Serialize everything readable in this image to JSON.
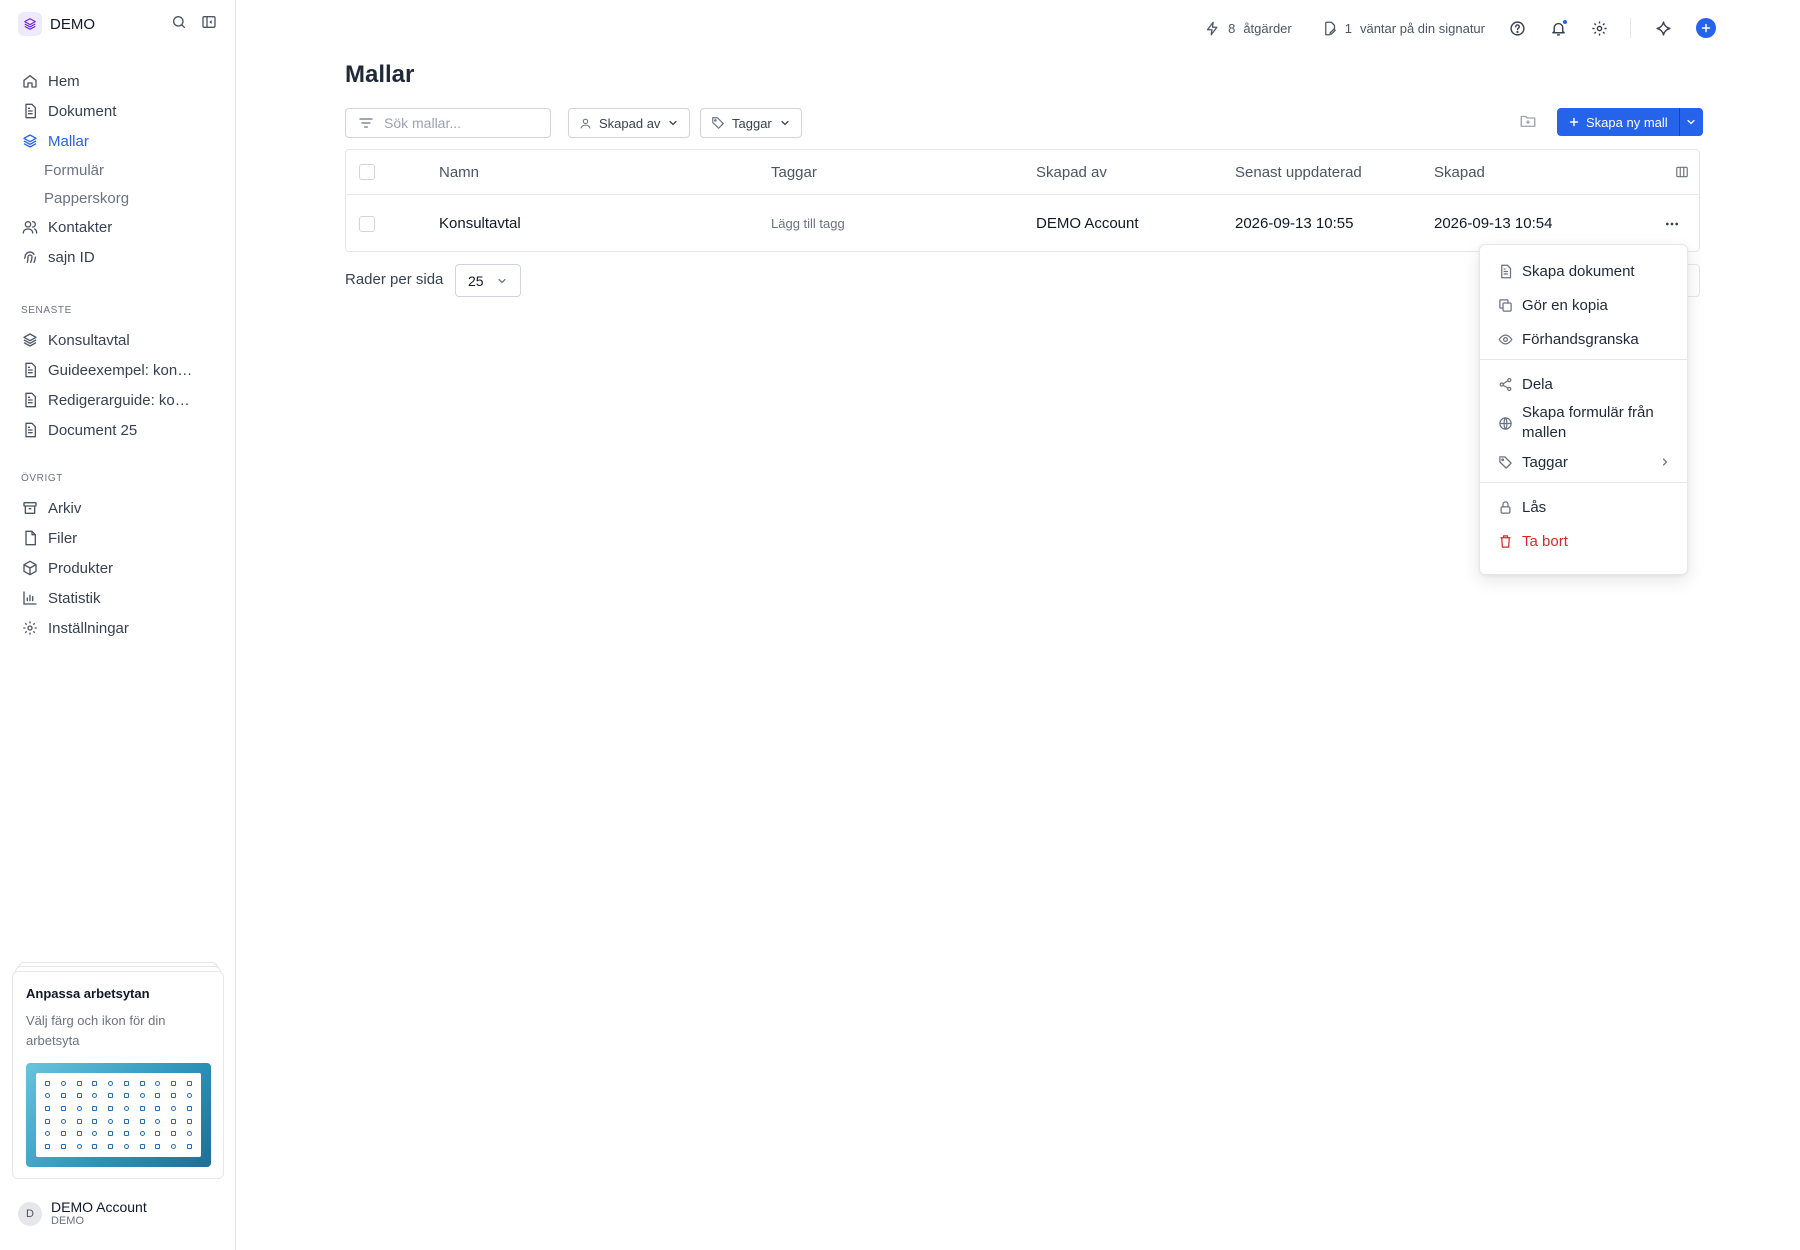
{
  "workspace": {
    "name": "DEMO"
  },
  "sidebar": {
    "nav": [
      {
        "label": "Hem",
        "icon": "home-icon"
      },
      {
        "label": "Dokument",
        "icon": "document-icon"
      },
      {
        "label": "Mallar",
        "icon": "layers-icon",
        "active": true
      },
      {
        "label": "Kontakter",
        "icon": "contacts-icon"
      },
      {
        "label": "sajn ID",
        "icon": "fingerprint-icon"
      }
    ],
    "sub": [
      {
        "label": "Formulär"
      },
      {
        "label": "Papperskorg"
      }
    ],
    "recent_heading": "SENASTE",
    "recent": [
      {
        "label": "Konsultavtal",
        "icon": "layers-icon"
      },
      {
        "label": "Guideexempel: konsultavtal",
        "icon": "document-icon"
      },
      {
        "label": "Redigerarguide: konsultavtal",
        "icon": "document-icon"
      },
      {
        "label": "Document 25",
        "icon": "document-icon"
      }
    ],
    "other_heading": "ÖVRIGT",
    "other": [
      {
        "label": "Arkiv",
        "icon": "archive-icon"
      },
      {
        "label": "Filer",
        "icon": "file-icon"
      },
      {
        "label": "Produkter",
        "icon": "box-icon"
      },
      {
        "label": "Statistik",
        "icon": "chart-icon"
      },
      {
        "label": "Inställningar",
        "icon": "gear-icon"
      }
    ],
    "promo": {
      "title": "Anpassa arbetsytan",
      "text": "Välj färg och ikon för din arbetsyta"
    },
    "account": {
      "name": "DEMO Account",
      "workspace": "DEMO",
      "initial": "D"
    }
  },
  "topbar": {
    "actions_count": "8",
    "actions_label": "åtgärder",
    "sign_count": "1",
    "sign_label": "väntar på din signatur"
  },
  "main": {
    "title": "Mallar",
    "search_placeholder": "Sök mallar...",
    "filter_created_by": "Skapad av",
    "filter_tags": "Taggar",
    "create_button": "Skapa ny mall",
    "columns": [
      "Namn",
      "Taggar",
      "Skapad av",
      "Senast uppdaterad",
      "Skapad"
    ],
    "rows": [
      {
        "name": "Konsultavtal",
        "tags": "Lägg till tagg",
        "created_by": "DEMO Account",
        "updated": "2026-09-13 10:55",
        "created": "2026-09-13 10:54"
      }
    ],
    "rows_per_page_label": "Rader per sida",
    "rows_per_page_value": "25"
  },
  "menu": {
    "items": [
      {
        "label": "Skapa dokument",
        "icon": "document-icon"
      },
      {
        "label": "Gör en kopia",
        "icon": "copy-icon"
      },
      {
        "label": "Förhandsgranska",
        "icon": "eye-icon"
      },
      {
        "label": "Dela",
        "icon": "share-icon"
      },
      {
        "label": "Skapa formulär från mallen",
        "icon": "globe-icon"
      },
      {
        "label": "Taggar",
        "icon": "tag-icon"
      },
      {
        "label": "Lås",
        "icon": "lock-icon"
      },
      {
        "label": "Ta bort",
        "icon": "trash-icon"
      }
    ]
  },
  "colors": {
    "accent": "#2563eb",
    "danger": "#dc2626",
    "border": "#e5e7eb"
  }
}
